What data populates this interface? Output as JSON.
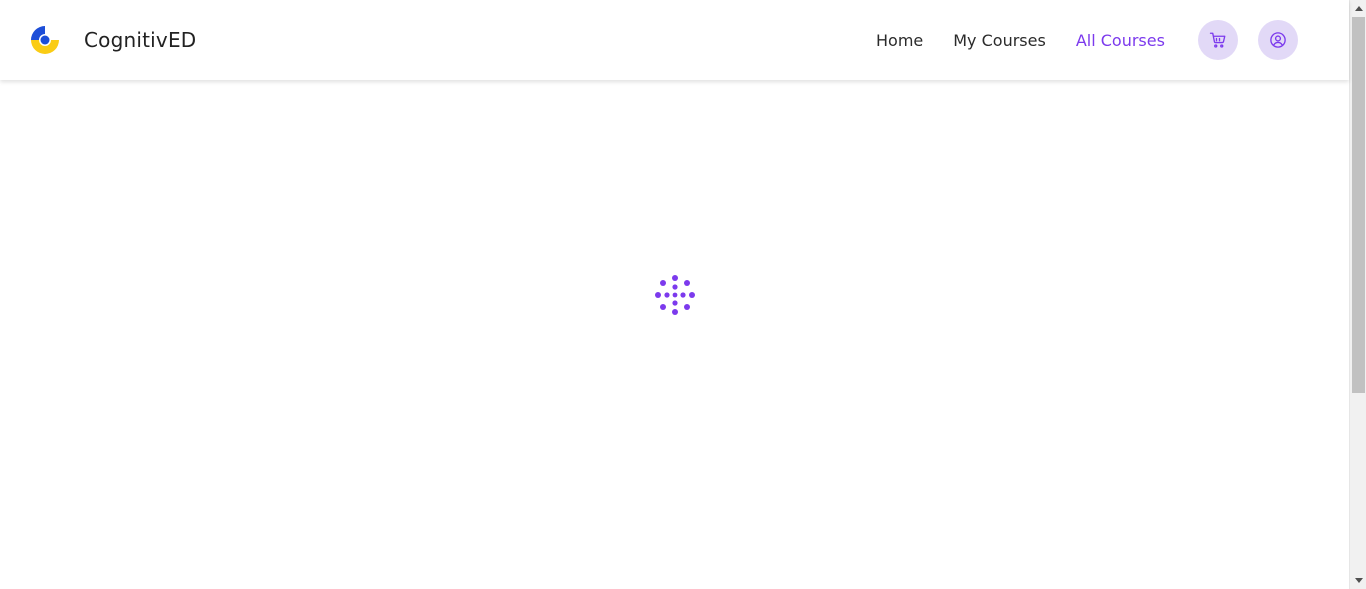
{
  "brand": {
    "name": "CognitivED",
    "logo_icon": "brand-logo-icon"
  },
  "nav": {
    "items": [
      {
        "label": "Home",
        "active": false
      },
      {
        "label": "My Courses",
        "active": false
      },
      {
        "label": "All Courses",
        "active": true
      }
    ],
    "cart_icon": "cart-icon",
    "user_icon": "user-circle-icon"
  },
  "main": {
    "loading_icon": "loading-spinner-icon"
  },
  "colors": {
    "accent": "#7c3aed",
    "icon_button_bg": "#e2d9f7",
    "logo_blue": "#1d4ed8",
    "logo_yellow": "#facc15",
    "text": "#2b2b2b"
  }
}
